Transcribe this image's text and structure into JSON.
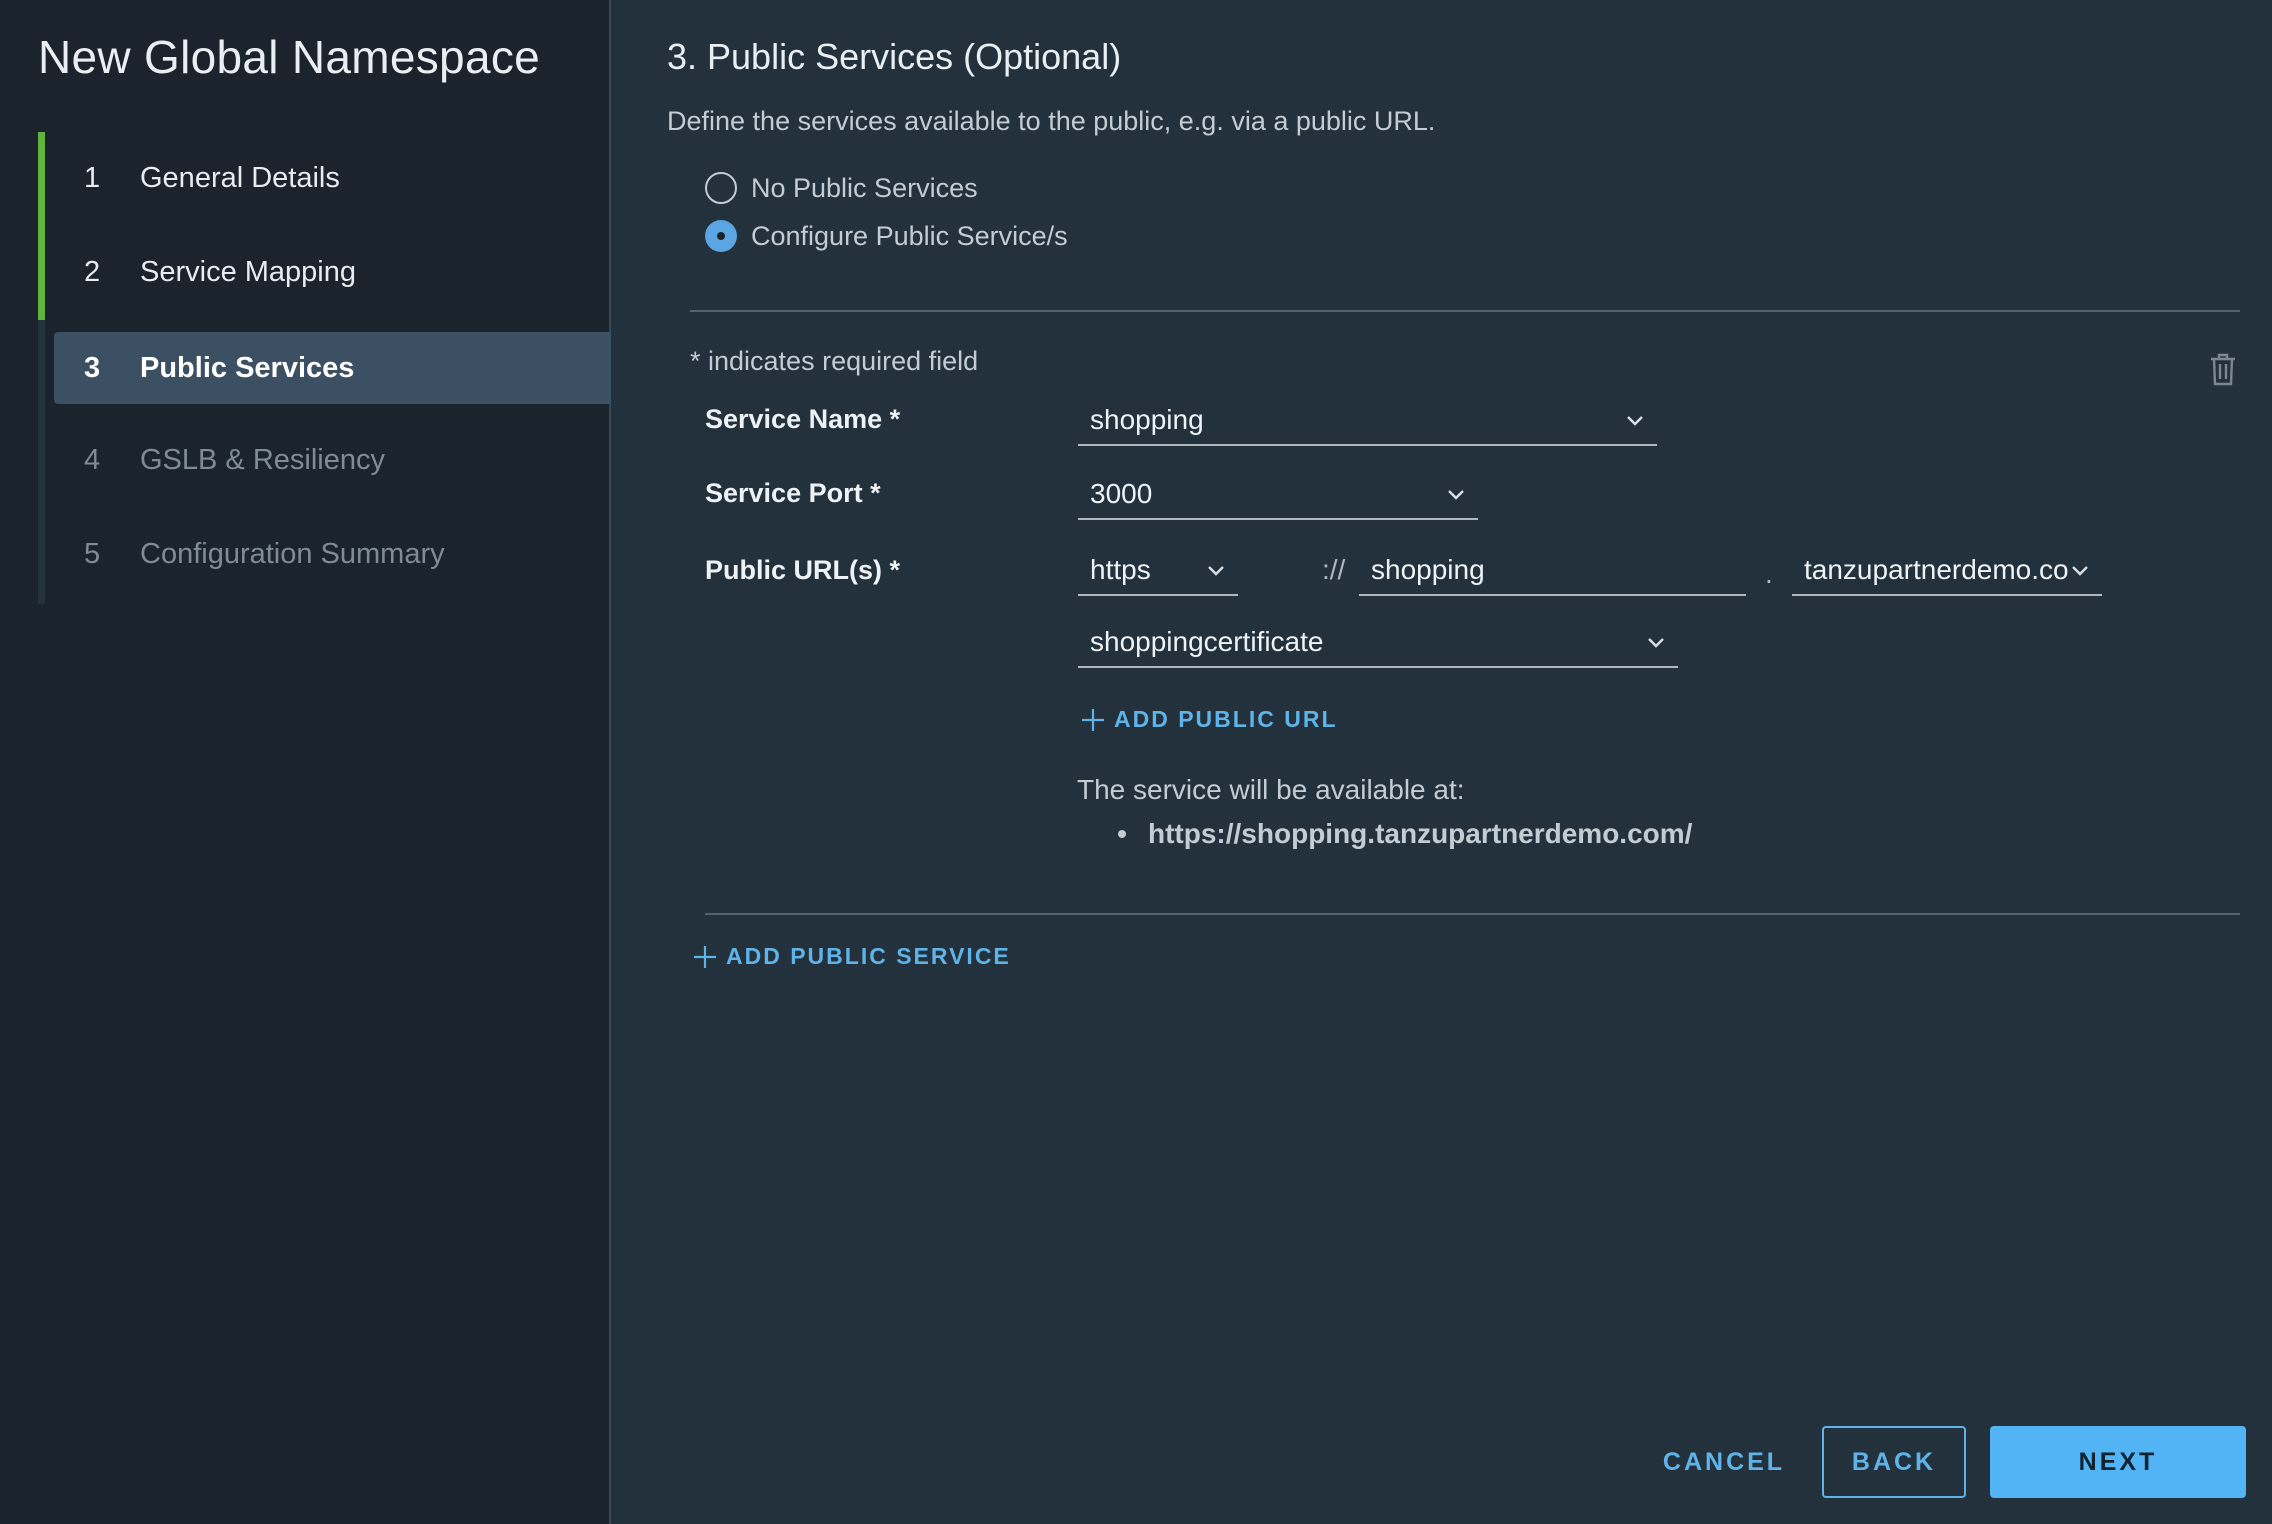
{
  "sidebar": {
    "title": "New Global Namespace",
    "steps": [
      {
        "num": "1",
        "label": "General Details"
      },
      {
        "num": "2",
        "label": "Service Mapping"
      },
      {
        "num": "3",
        "label": "Public Services"
      },
      {
        "num": "4",
        "label": "GSLB & Resiliency"
      },
      {
        "num": "5",
        "label": "Configuration Summary"
      }
    ],
    "current_step": 3
  },
  "main": {
    "title": "3. Public Services (Optional)",
    "description": "Define the services available to the public, e.g. via a public URL.",
    "radio_options": [
      {
        "label": "No Public Services",
        "checked": false
      },
      {
        "label": "Configure Public Service/s",
        "checked": true
      }
    ],
    "required_note": "* indicates required field",
    "form": {
      "service_name_label": "Service Name *",
      "service_name_value": "shopping",
      "service_port_label": "Service Port *",
      "service_port_value": "3000",
      "public_url_label": "Public URL(s) *",
      "protocol_value": "https",
      "scheme_separator": "://",
      "subdomain_value": "shopping",
      "dot_separator": ".",
      "domain_value": "tanzupartnerdemo.com",
      "certificate_value": "shoppingcertificate",
      "add_public_url_label": "ADD PUBLIC URL",
      "available_label": "The service will be available at:",
      "available_urls": [
        "https://shopping.tanzupartnerdemo.com/"
      ]
    },
    "add_public_service_label": "ADD PUBLIC SERVICE"
  },
  "footer": {
    "cancel_label": "CANCEL",
    "back_label": "BACK",
    "next_label": "NEXT"
  },
  "colors": {
    "accent": "#5fb3e8",
    "primary_button": "#52b4f5",
    "step_done": "#62b33b",
    "active_step_bg": "#3b5063"
  },
  "icons": {
    "dropdown": "chevron-down-icon",
    "delete": "trash-icon",
    "add": "plus-icon"
  }
}
